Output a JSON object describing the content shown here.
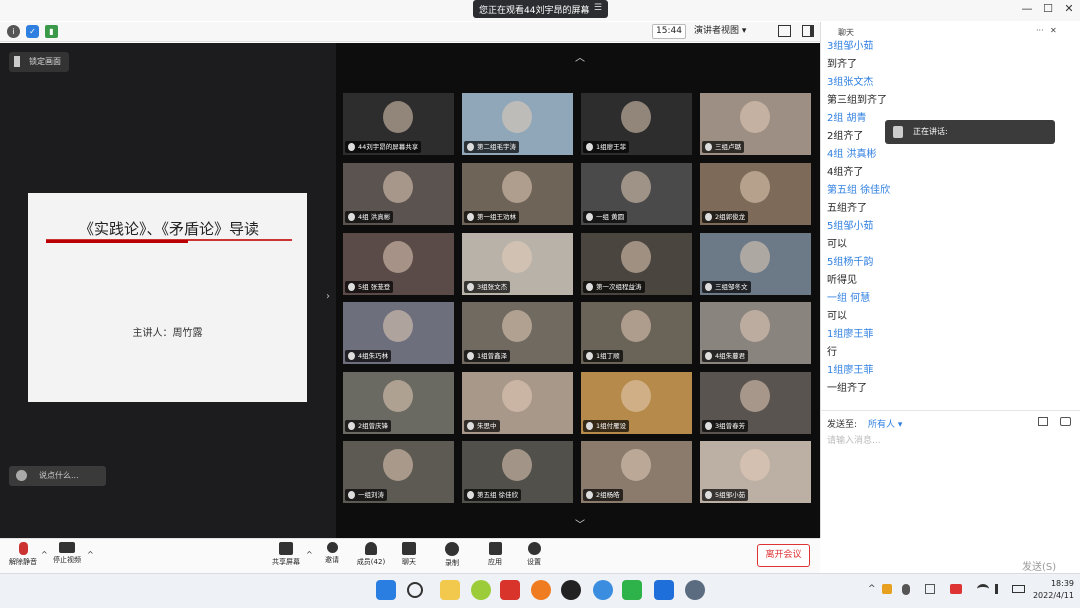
{
  "window": {
    "share_banner": "您正在观看44刘宇昂的屏幕",
    "min": "—",
    "max": "☐",
    "close": "✕"
  },
  "toolbar": {
    "time": "15:44",
    "view_label": "演讲者视图 ▾"
  },
  "left": {
    "lock_label": "锁定画面",
    "slide_title": "《实践论》、《矛盾论》导读",
    "slide_presenter": "主讲人：周竹露",
    "comment_placeholder": "说点什么..."
  },
  "tiles": [
    {
      "label": "44刘宇昂的屏幕共享",
      "color": "#2d2d2d"
    },
    {
      "label": "第二组毛宇涛",
      "color": "#8fa7b8"
    },
    {
      "label": "1组廖王菲",
      "color": "#2d2d2d"
    },
    {
      "label": "三组卢璐",
      "color": "#9d8f84"
    },
    {
      "label": "4组 洪真彬",
      "color": "#5b5350"
    },
    {
      "label": "第一组王劝林",
      "color": "#6e6458"
    },
    {
      "label": "一组 黄圆",
      "color": "#4a4a4a"
    },
    {
      "label": "2组郭俊龙",
      "color": "#7d6a58"
    },
    {
      "label": "5组 张茏登",
      "color": "#5a4a48"
    },
    {
      "label": "3组张文杰",
      "color": "#b9b2a8"
    },
    {
      "label": "第一次组程益涛",
      "color": "#4a463f"
    },
    {
      "label": "三组邹冬文",
      "color": "#6c7a88"
    },
    {
      "label": "4组朱巧林",
      "color": "#6e6f7d"
    },
    {
      "label": "1组曾鑫泽",
      "color": "#716a61"
    },
    {
      "label": "1组丁顺",
      "color": "#6a6358"
    },
    {
      "label": "4组朱蔓君",
      "color": "#8a847e"
    },
    {
      "label": "2组曾庆锋",
      "color": "#6b6a62"
    },
    {
      "label": "朱思中",
      "color": "#a8988a"
    },
    {
      "label": "1组付雁设",
      "color": "#b58a4a"
    },
    {
      "label": "3组曾春芳",
      "color": "#5a5450"
    },
    {
      "label": "一组刘涛",
      "color": "#5d5953"
    },
    {
      "label": "第五组 徐佳欣",
      "color": "#51504b"
    },
    {
      "label": "2组杨皓",
      "color": "#8a7b6d"
    },
    {
      "label": "5组邹小茹",
      "color": "#bcb0a5"
    }
  ],
  "chat": {
    "title": "聊天",
    "messages": [
      {
        "text": "3组邹小茹",
        "name": true
      },
      {
        "text": "到齐了",
        "name": false
      },
      {
        "text": "3组张文杰",
        "name": true
      },
      {
        "text": "第三组到齐了",
        "name": false
      },
      {
        "text": "2组  胡青",
        "name": true
      },
      {
        "text": "2组齐了",
        "name": false
      },
      {
        "text": "4组 洪真彬",
        "name": true
      },
      {
        "text": "4组齐了",
        "name": false
      },
      {
        "text": "第五组 徐佳欣",
        "name": true
      },
      {
        "text": "五组齐了",
        "name": false
      },
      {
        "text": "5组邹小茹",
        "name": true
      },
      {
        "text": "可以",
        "name": false
      },
      {
        "text": "5组杨千韵",
        "name": true
      },
      {
        "text": "听得见",
        "name": false
      },
      {
        "text": "一组  何慧",
        "name": true
      },
      {
        "text": "可以",
        "name": false
      },
      {
        "text": "1组廖王菲",
        "name": true
      },
      {
        "text": "行",
        "name": false
      },
      {
        "text": "1组廖王菲",
        "name": true
      },
      {
        "text": "一组齐了",
        "name": false
      }
    ],
    "speaking_label": "正在讲话:",
    "send_to_label": "发送至:",
    "send_to_value": "所有人 ▾",
    "input_placeholder": "请输入消息...",
    "send_button": "发送(S)"
  },
  "bottom": {
    "mute": "解除静音",
    "video": "停止视频",
    "share": "共享屏幕",
    "invite": "邀请",
    "members": "成员(42)",
    "chat": "聊天",
    "record": "录制",
    "apps": "应用",
    "settings": "设置",
    "leave": "离开会议"
  },
  "taskbar": {
    "time": "18:39",
    "date": "2022/4/11"
  }
}
